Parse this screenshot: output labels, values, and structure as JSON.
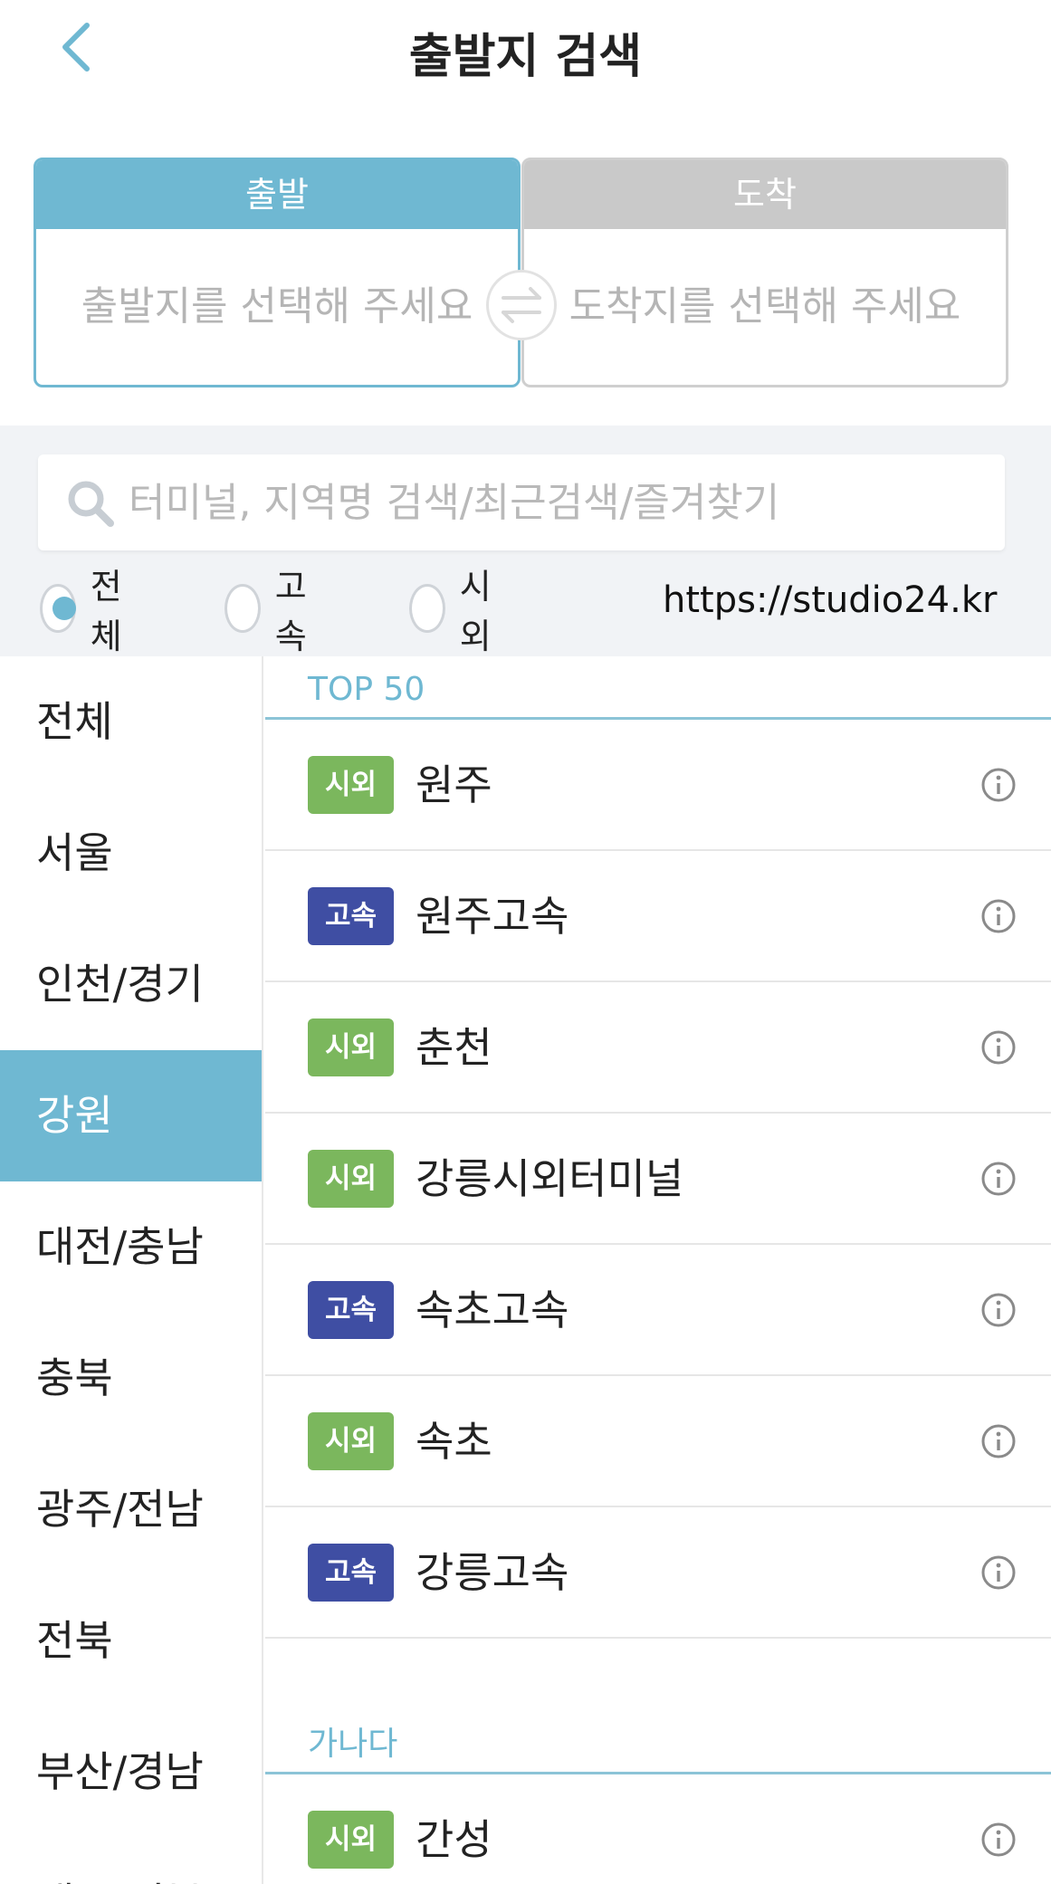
{
  "header": {
    "title": "출발지 검색"
  },
  "route": {
    "depart_label": "출발",
    "depart_placeholder": "출발지를 선택해 주세요",
    "arrive_label": "도착",
    "arrive_placeholder": "도착지를 선택해 주세요"
  },
  "search": {
    "placeholder": "터미널, 지역명 검색/최근검색/즐겨찾기"
  },
  "filters": [
    {
      "label": "전체",
      "selected": true
    },
    {
      "label": "고속",
      "selected": false
    },
    {
      "label": "시외",
      "selected": false
    }
  ],
  "watermark": "https://studio24.kr",
  "sidebar": {
    "items": [
      "전체",
      "서울",
      "인천/경기",
      "강원",
      "대전/충남",
      "충북",
      "광주/전남",
      "전북",
      "부산/경남",
      "대구/경북"
    ],
    "active": "강원"
  },
  "sections": [
    {
      "title": "TOP 50",
      "stations": [
        {
          "type": "시외",
          "name": "원주"
        },
        {
          "type": "고속",
          "name": "원주고속"
        },
        {
          "type": "시외",
          "name": "춘천"
        },
        {
          "type": "시외",
          "name": "강릉시외터미널"
        },
        {
          "type": "고속",
          "name": "속초고속"
        },
        {
          "type": "시외",
          "name": "속초"
        },
        {
          "type": "고속",
          "name": "강릉고속"
        }
      ]
    },
    {
      "title": "가나다",
      "stations": [
        {
          "type": "시외",
          "name": "간성"
        }
      ]
    }
  ],
  "colors": {
    "accent": "#6fb8d2",
    "intercity": "#7bb75d",
    "express": "#3f4ea3",
    "inactive": "#c9c9c9"
  },
  "icons": {
    "back": "chevron-left-icon",
    "swap": "swap-arrows-icon",
    "search": "magnifier-icon",
    "info": "info-circle-icon"
  }
}
